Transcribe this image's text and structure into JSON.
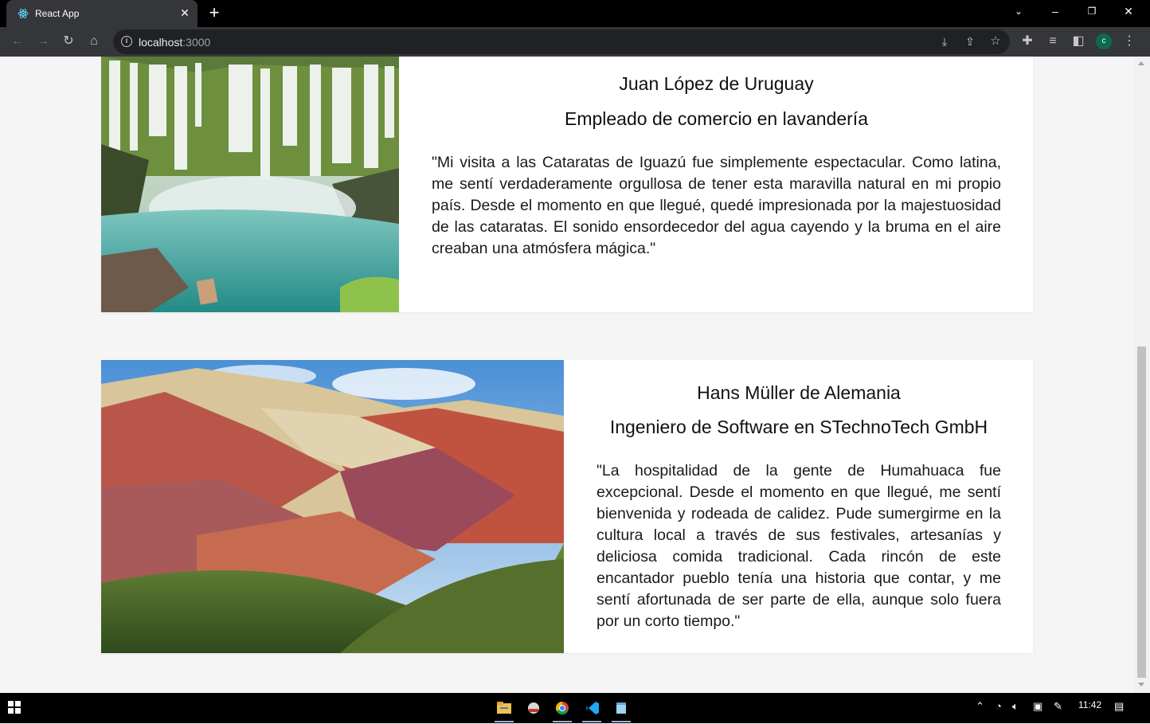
{
  "browser": {
    "tab_title": "React App",
    "url_host": "localhost",
    "url_port": ":3000",
    "profile_initial": "c"
  },
  "testimonials": [
    {
      "name": "Juan López de Uruguay",
      "role": "Empleado de comercio en lavandería",
      "quote": "\"Mi visita a las Cataratas de Iguazú fue simplemente espectacular. Como latina, me sentí verdaderamente orgullosa de tener esta maravilla natural en mi propio país. Desde el momento en que llegué, quedé impresionada por la majestuosidad de las cataratas. El sonido ensordecedor del agua cayendo y la bruma en el aire creaban una atmósfera mágica.\""
    },
    {
      "name": "Hans Müller de Alemania",
      "role": "Ingeniero de Software en STechnoTech GmbH",
      "quote": "\"La hospitalidad de la gente de Humahuaca fue excepcional. Desde el momento en que llegué, me sentí bienvenida y rodeada de calidez. Pude sumergirme en la cultura local a través de sus festivales, artesanías y deliciosa comida tradicional. Cada rincón de este encantador pueblo tenía una historia que contar, y me sentí afortunada de ser parte de ella, aunque solo fuera por un corto tiempo.\""
    }
  ],
  "taskbar": {
    "clock": "11:42"
  },
  "colors": {
    "page_background": "#f5f5f5",
    "card_background": "#ffffff",
    "browser_toolbar": "#35363a",
    "tabstrip": "#000000"
  }
}
